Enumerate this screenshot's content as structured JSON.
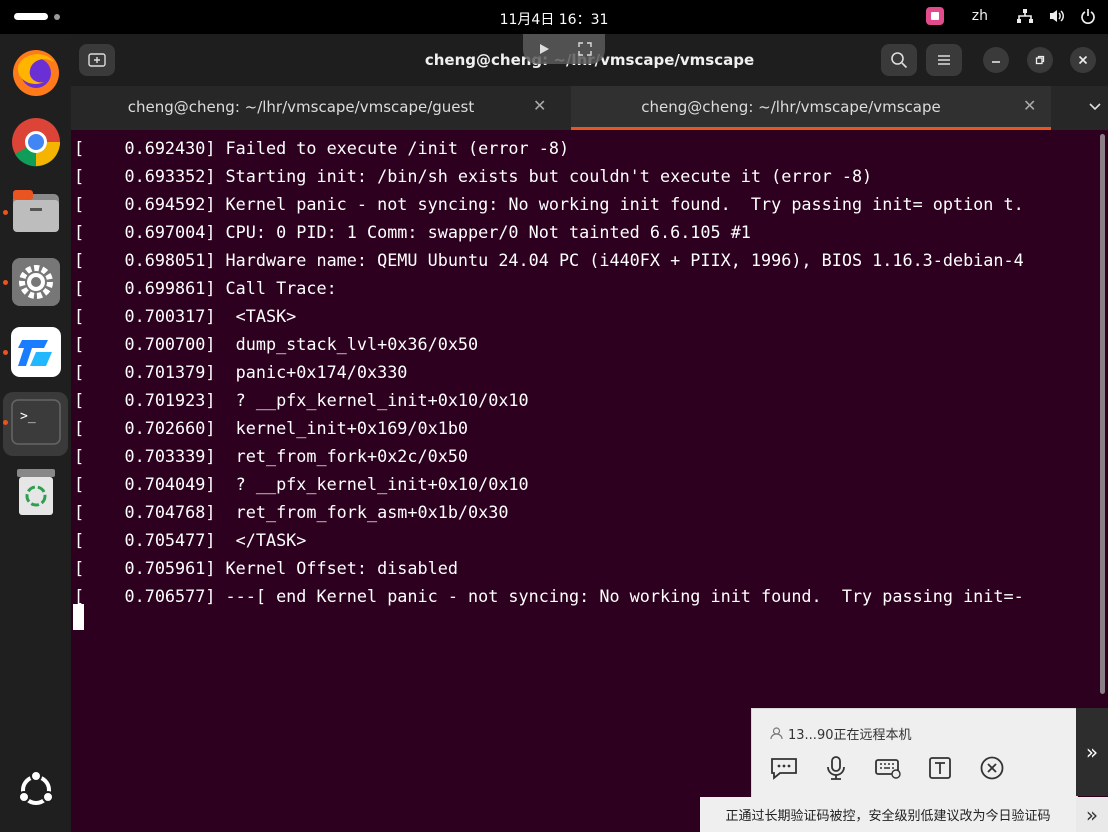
{
  "topbar": {
    "clock": "11月4日  16：31",
    "input_method": "zh"
  },
  "dock": {
    "apps": [
      {
        "name": "Firefox",
        "icon": "firefox-icon"
      },
      {
        "name": "Chrome",
        "icon": "chrome-icon"
      },
      {
        "name": "Files",
        "icon": "files-icon"
      },
      {
        "name": "Settings",
        "icon": "settings-icon"
      },
      {
        "name": "ToDesk",
        "icon": "remote-desktop-icon"
      },
      {
        "name": "Terminal",
        "icon": "terminal-icon"
      },
      {
        "name": "Trash",
        "icon": "trash-icon"
      }
    ],
    "launcher_icon": "ubuntu-icon",
    "terminal_glyph": ">_"
  },
  "window": {
    "title": "cheng@cheng: ~/lhr/vmscape/vmscape",
    "tabs": [
      {
        "label": "cheng@cheng: ~/lhr/vmscape/vmscape/guest",
        "active": false
      },
      {
        "label": "cheng@cheng: ~/lhr/vmscape/vmscape",
        "active": true
      }
    ]
  },
  "terminal": {
    "lines": [
      "[    0.692430] Failed to execute /init (error -8)",
      "[    0.693352] Starting init: /bin/sh exists but couldn't execute it (error -8)",
      "[    0.694592] Kernel panic - not syncing: No working init found.  Try passing init= option t.",
      "[    0.697004] CPU: 0 PID: 1 Comm: swapper/0 Not tainted 6.6.105 #1",
      "[    0.698051] Hardware name: QEMU Ubuntu 24.04 PC (i440FX + PIIX, 1996), BIOS 1.16.3-debian-4",
      "[    0.699861] Call Trace:",
      "[    0.700317]  <TASK>",
      "[    0.700700]  dump_stack_lvl+0x36/0x50",
      "[    0.701379]  panic+0x174/0x330",
      "[    0.701923]  ? __pfx_kernel_init+0x10/0x10",
      "[    0.702660]  kernel_init+0x169/0x1b0",
      "[    0.703339]  ret_from_fork+0x2c/0x50",
      "[    0.704049]  ? __pfx_kernel_init+0x10/0x10",
      "[    0.704768]  ret_from_fork_asm+0x1b/0x30",
      "[    0.705477]  </TASK>",
      "[    0.705961] Kernel Offset: disabled",
      "[    0.706577] ---[ end Kernel panic - not syncing: No working init found.  Try passing init=-"
    ]
  },
  "remote_panel": {
    "status": "13...90正在远程本机",
    "tools": [
      "chat-icon",
      "microphone-icon",
      "keyboard-icon",
      "text-icon",
      "disconnect-icon"
    ],
    "collapse_glyph": "»"
  },
  "notice": {
    "text": "正通过长期验证码被控，安全级别低建议改为今日验证码",
    "arrow_glyph": "»"
  },
  "colors": {
    "terminal_bg": "#2c001e",
    "accent": "#e95420"
  }
}
